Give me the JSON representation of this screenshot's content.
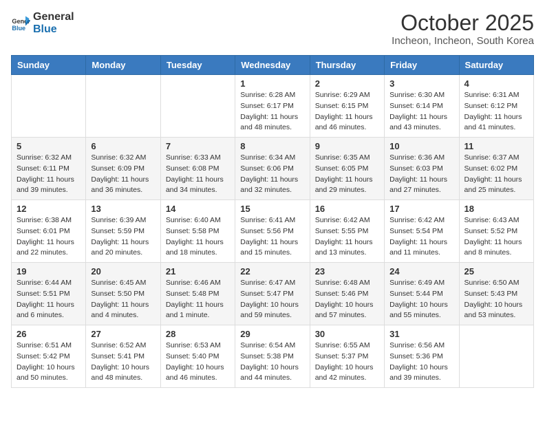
{
  "logo": {
    "general": "General",
    "blue": "Blue"
  },
  "header": {
    "month": "October 2025",
    "location": "Incheon, Incheon, South Korea"
  },
  "weekdays": [
    "Sunday",
    "Monday",
    "Tuesday",
    "Wednesday",
    "Thursday",
    "Friday",
    "Saturday"
  ],
  "weeks": [
    [
      {
        "day": "",
        "sunrise": "",
        "sunset": "",
        "daylight": ""
      },
      {
        "day": "",
        "sunrise": "",
        "sunset": "",
        "daylight": ""
      },
      {
        "day": "",
        "sunrise": "",
        "sunset": "",
        "daylight": ""
      },
      {
        "day": "1",
        "sunrise": "Sunrise: 6:28 AM",
        "sunset": "Sunset: 6:17 PM",
        "daylight": "Daylight: 11 hours and 48 minutes."
      },
      {
        "day": "2",
        "sunrise": "Sunrise: 6:29 AM",
        "sunset": "Sunset: 6:15 PM",
        "daylight": "Daylight: 11 hours and 46 minutes."
      },
      {
        "day": "3",
        "sunrise": "Sunrise: 6:30 AM",
        "sunset": "Sunset: 6:14 PM",
        "daylight": "Daylight: 11 hours and 43 minutes."
      },
      {
        "day": "4",
        "sunrise": "Sunrise: 6:31 AM",
        "sunset": "Sunset: 6:12 PM",
        "daylight": "Daylight: 11 hours and 41 minutes."
      }
    ],
    [
      {
        "day": "5",
        "sunrise": "Sunrise: 6:32 AM",
        "sunset": "Sunset: 6:11 PM",
        "daylight": "Daylight: 11 hours and 39 minutes."
      },
      {
        "day": "6",
        "sunrise": "Sunrise: 6:32 AM",
        "sunset": "Sunset: 6:09 PM",
        "daylight": "Daylight: 11 hours and 36 minutes."
      },
      {
        "day": "7",
        "sunrise": "Sunrise: 6:33 AM",
        "sunset": "Sunset: 6:08 PM",
        "daylight": "Daylight: 11 hours and 34 minutes."
      },
      {
        "day": "8",
        "sunrise": "Sunrise: 6:34 AM",
        "sunset": "Sunset: 6:06 PM",
        "daylight": "Daylight: 11 hours and 32 minutes."
      },
      {
        "day": "9",
        "sunrise": "Sunrise: 6:35 AM",
        "sunset": "Sunset: 6:05 PM",
        "daylight": "Daylight: 11 hours and 29 minutes."
      },
      {
        "day": "10",
        "sunrise": "Sunrise: 6:36 AM",
        "sunset": "Sunset: 6:03 PM",
        "daylight": "Daylight: 11 hours and 27 minutes."
      },
      {
        "day": "11",
        "sunrise": "Sunrise: 6:37 AM",
        "sunset": "Sunset: 6:02 PM",
        "daylight": "Daylight: 11 hours and 25 minutes."
      }
    ],
    [
      {
        "day": "12",
        "sunrise": "Sunrise: 6:38 AM",
        "sunset": "Sunset: 6:01 PM",
        "daylight": "Daylight: 11 hours and 22 minutes."
      },
      {
        "day": "13",
        "sunrise": "Sunrise: 6:39 AM",
        "sunset": "Sunset: 5:59 PM",
        "daylight": "Daylight: 11 hours and 20 minutes."
      },
      {
        "day": "14",
        "sunrise": "Sunrise: 6:40 AM",
        "sunset": "Sunset: 5:58 PM",
        "daylight": "Daylight: 11 hours and 18 minutes."
      },
      {
        "day": "15",
        "sunrise": "Sunrise: 6:41 AM",
        "sunset": "Sunset: 5:56 PM",
        "daylight": "Daylight: 11 hours and 15 minutes."
      },
      {
        "day": "16",
        "sunrise": "Sunrise: 6:42 AM",
        "sunset": "Sunset: 5:55 PM",
        "daylight": "Daylight: 11 hours and 13 minutes."
      },
      {
        "day": "17",
        "sunrise": "Sunrise: 6:42 AM",
        "sunset": "Sunset: 5:54 PM",
        "daylight": "Daylight: 11 hours and 11 minutes."
      },
      {
        "day": "18",
        "sunrise": "Sunrise: 6:43 AM",
        "sunset": "Sunset: 5:52 PM",
        "daylight": "Daylight: 11 hours and 8 minutes."
      }
    ],
    [
      {
        "day": "19",
        "sunrise": "Sunrise: 6:44 AM",
        "sunset": "Sunset: 5:51 PM",
        "daylight": "Daylight: 11 hours and 6 minutes."
      },
      {
        "day": "20",
        "sunrise": "Sunrise: 6:45 AM",
        "sunset": "Sunset: 5:50 PM",
        "daylight": "Daylight: 11 hours and 4 minutes."
      },
      {
        "day": "21",
        "sunrise": "Sunrise: 6:46 AM",
        "sunset": "Sunset: 5:48 PM",
        "daylight": "Daylight: 11 hours and 1 minute."
      },
      {
        "day": "22",
        "sunrise": "Sunrise: 6:47 AM",
        "sunset": "Sunset: 5:47 PM",
        "daylight": "Daylight: 10 hours and 59 minutes."
      },
      {
        "day": "23",
        "sunrise": "Sunrise: 6:48 AM",
        "sunset": "Sunset: 5:46 PM",
        "daylight": "Daylight: 10 hours and 57 minutes."
      },
      {
        "day": "24",
        "sunrise": "Sunrise: 6:49 AM",
        "sunset": "Sunset: 5:44 PM",
        "daylight": "Daylight: 10 hours and 55 minutes."
      },
      {
        "day": "25",
        "sunrise": "Sunrise: 6:50 AM",
        "sunset": "Sunset: 5:43 PM",
        "daylight": "Daylight: 10 hours and 53 minutes."
      }
    ],
    [
      {
        "day": "26",
        "sunrise": "Sunrise: 6:51 AM",
        "sunset": "Sunset: 5:42 PM",
        "daylight": "Daylight: 10 hours and 50 minutes."
      },
      {
        "day": "27",
        "sunrise": "Sunrise: 6:52 AM",
        "sunset": "Sunset: 5:41 PM",
        "daylight": "Daylight: 10 hours and 48 minutes."
      },
      {
        "day": "28",
        "sunrise": "Sunrise: 6:53 AM",
        "sunset": "Sunset: 5:40 PM",
        "daylight": "Daylight: 10 hours and 46 minutes."
      },
      {
        "day": "29",
        "sunrise": "Sunrise: 6:54 AM",
        "sunset": "Sunset: 5:38 PM",
        "daylight": "Daylight: 10 hours and 44 minutes."
      },
      {
        "day": "30",
        "sunrise": "Sunrise: 6:55 AM",
        "sunset": "Sunset: 5:37 PM",
        "daylight": "Daylight: 10 hours and 42 minutes."
      },
      {
        "day": "31",
        "sunrise": "Sunrise: 6:56 AM",
        "sunset": "Sunset: 5:36 PM",
        "daylight": "Daylight: 10 hours and 39 minutes."
      },
      {
        "day": "",
        "sunrise": "",
        "sunset": "",
        "daylight": ""
      }
    ]
  ]
}
